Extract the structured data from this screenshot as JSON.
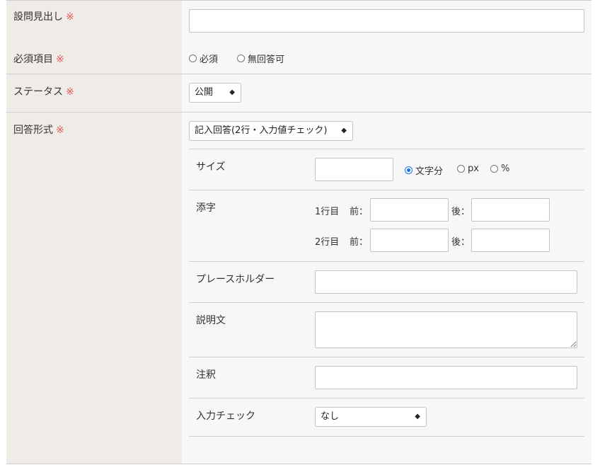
{
  "fields": {
    "heading": {
      "label": "設問見出し",
      "required_mark": "※",
      "value": ""
    },
    "required": {
      "label": "必須項目",
      "required_mark": "※",
      "options": [
        "必須",
        "無回答可"
      ]
    },
    "status": {
      "label": "ステータス",
      "required_mark": "※",
      "selected": "公開"
    },
    "answer_format": {
      "label": "回答形式",
      "required_mark": "※",
      "selected": "記入回答(2行・入力値チェック)"
    }
  },
  "details": {
    "size": {
      "label": "サイズ",
      "value": "",
      "units": [
        "文字分",
        "px",
        "%"
      ],
      "selected_unit": "文字分"
    },
    "affix": {
      "label": "添字",
      "rows": [
        {
          "row_label": "1行目",
          "before_label": "前：",
          "after_label": "後：",
          "before": "",
          "after": ""
        },
        {
          "row_label": "2行目",
          "before_label": "前：",
          "after_label": "後：",
          "before": "",
          "after": ""
        }
      ]
    },
    "placeholder": {
      "label": "プレースホルダー",
      "value": ""
    },
    "description": {
      "label": "説明文",
      "value": ""
    },
    "note": {
      "label": "注釈",
      "value": ""
    },
    "input_check": {
      "label": "入力チェック",
      "selected": "なし"
    }
  },
  "colors": {
    "label_bg": "#efebe6",
    "value_bg": "#f7f7f7",
    "required": "#e05a5a",
    "radio_accent": "#1a73e8"
  }
}
